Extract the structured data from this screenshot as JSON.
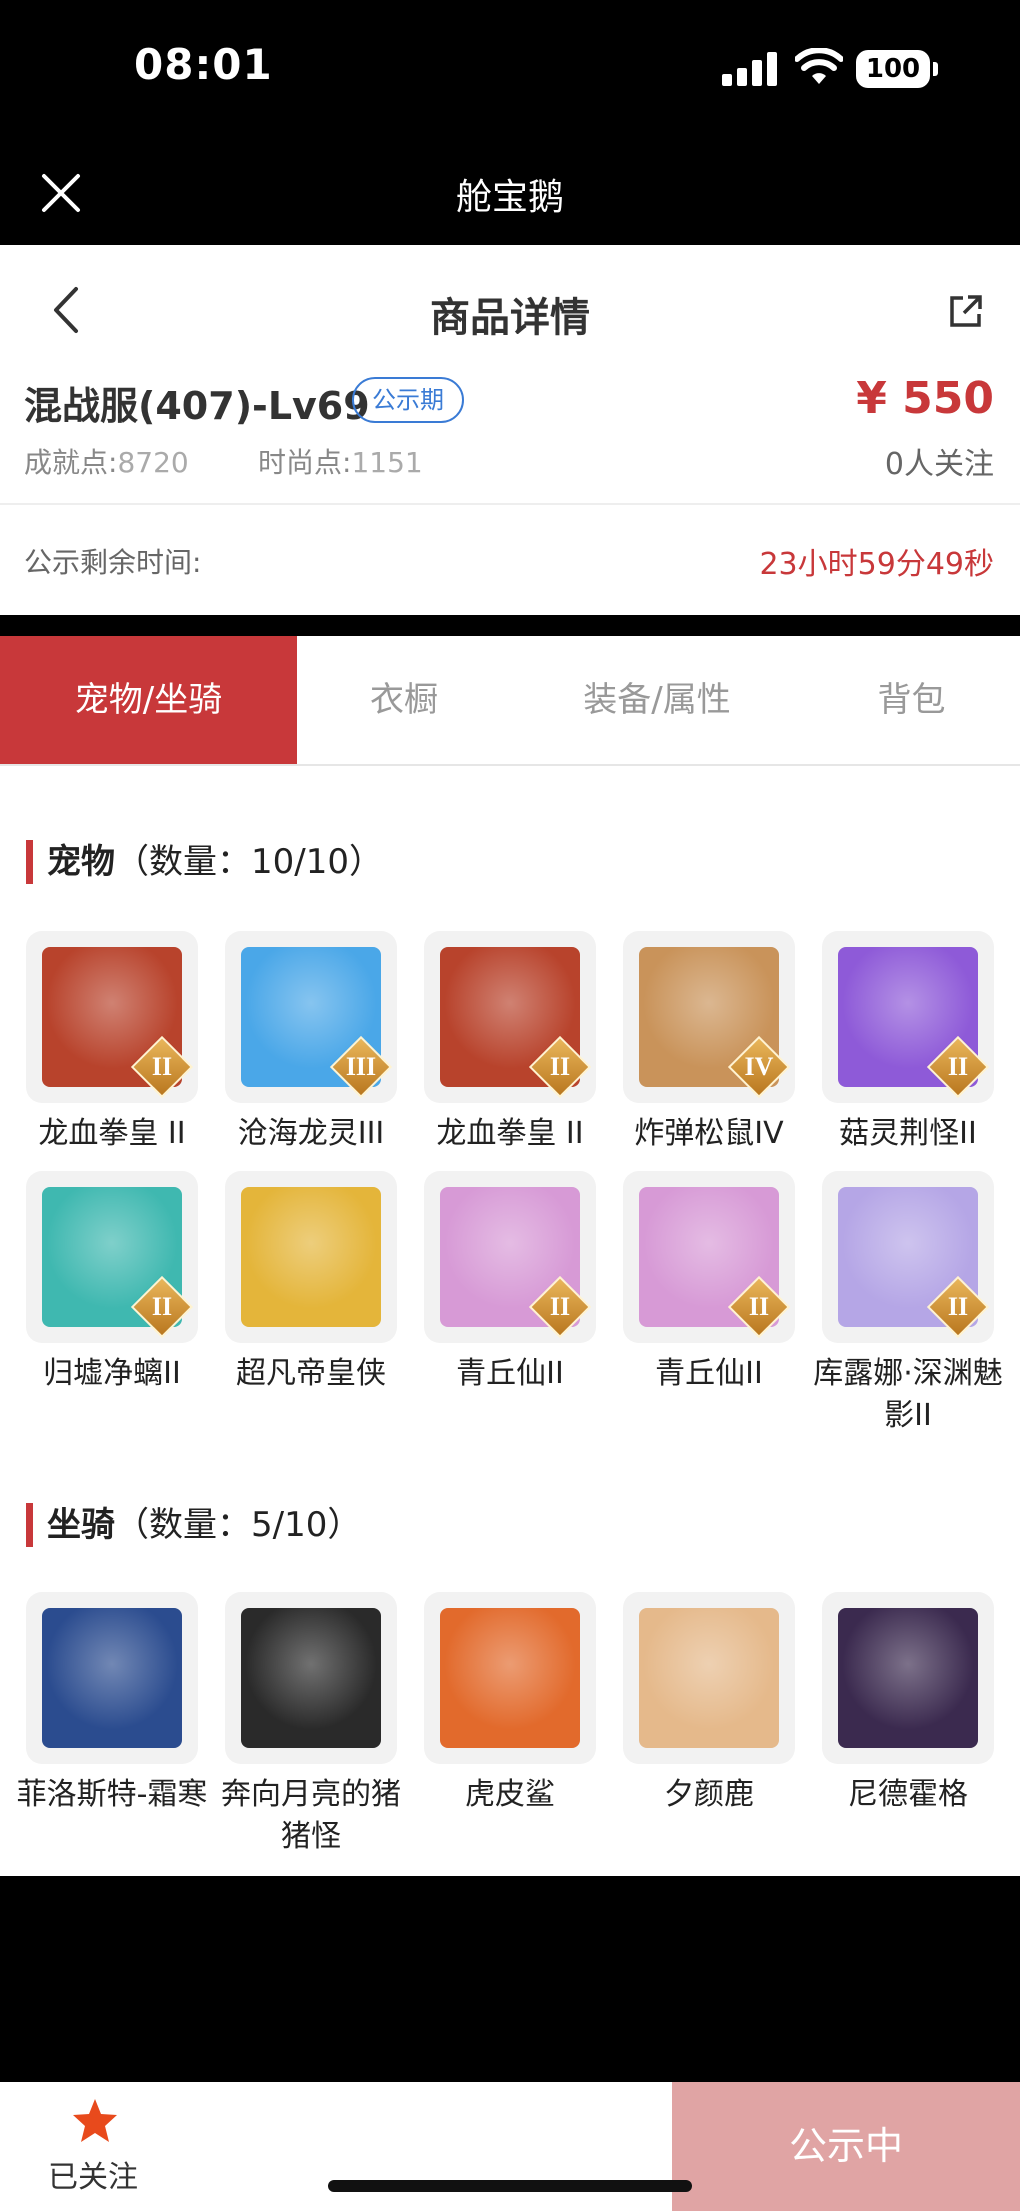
{
  "status_bar": {
    "time": "08:01",
    "battery": "100"
  },
  "app_bar": {
    "title": "舱宝鹅"
  },
  "header": {
    "title": "商品详情"
  },
  "product": {
    "name": "混战服(407)-Lv69",
    "badge": "公示期",
    "price": "¥ 550",
    "followers": "0人关注",
    "achievement_label": "成就点:",
    "achievement_value": "8720",
    "fashion_label": "时尚点:",
    "fashion_value": "1151"
  },
  "countdown": {
    "label": "公示剩余时间:",
    "value": "23小时59分49秒"
  },
  "tabs": [
    {
      "label": "宠物/坐骑",
      "active": true
    },
    {
      "label": "衣橱",
      "active": false
    },
    {
      "label": "装备/属性",
      "active": false
    },
    {
      "label": "背包",
      "active": false
    }
  ],
  "pets": {
    "title": "宠物",
    "count": "（数量：10/10）",
    "items": [
      {
        "name": "龙血拳皇 II",
        "tier": "II",
        "color": "#b8432c"
      },
      {
        "name": "沧海龙灵III",
        "tier": "III",
        "color": "#4aa7e8"
      },
      {
        "name": "龙血拳皇 II",
        "tier": "II",
        "color": "#b8432c"
      },
      {
        "name": "炸弹松鼠IV",
        "tier": "IV",
        "color": "#c9935a"
      },
      {
        "name": "菇灵荆怪II",
        "tier": "II",
        "color": "#8e5ad8"
      },
      {
        "name": "归墟净螭II",
        "tier": "II",
        "color": "#3fb8b0"
      },
      {
        "name": "超凡帝皇侠",
        "tier": "",
        "color": "#e4b53a"
      },
      {
        "name": "青丘仙II",
        "tier": "II",
        "color": "#d79ad6"
      },
      {
        "name": "青丘仙II",
        "tier": "II",
        "color": "#d79ad6"
      },
      {
        "name": "库露娜·深渊魅影II",
        "tier": "II",
        "color": "#b5a6e6"
      }
    ]
  },
  "mounts": {
    "title": "坐骑",
    "count": "（数量：5/10）",
    "items": [
      {
        "name": "菲洛斯特-霜寒",
        "color": "#2b4c8f"
      },
      {
        "name": "奔向月亮的猪猪怪",
        "color": "#2a2a2a"
      },
      {
        "name": "虎皮鲨",
        "color": "#e26a2c"
      },
      {
        "name": "夕颜鹿",
        "color": "#e5b98b"
      },
      {
        "name": "尼德霍格",
        "color": "#3b2a4f"
      }
    ]
  },
  "bottom_bar": {
    "follow_label": "已关注",
    "cta_label": "公示中"
  }
}
